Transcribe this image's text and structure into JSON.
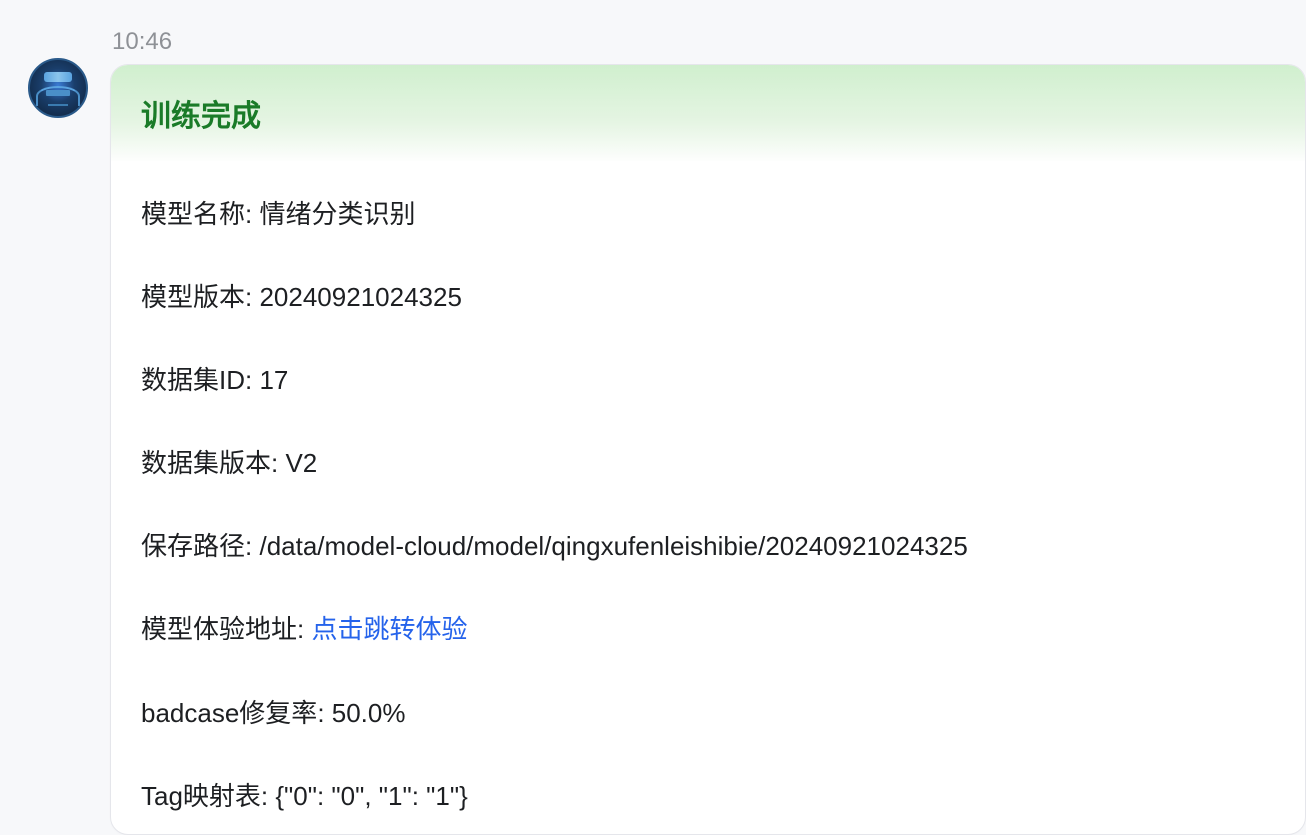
{
  "timestamp": "10:46",
  "header": {
    "title": "训练完成"
  },
  "fields": {
    "model_name": {
      "label": "模型名称",
      "value": "情绪分类识别"
    },
    "model_version": {
      "label": "模型版本",
      "value": "20240921024325"
    },
    "dataset_id": {
      "label": "数据集ID",
      "value": "17"
    },
    "dataset_version": {
      "label": "数据集版本",
      "value": "V2"
    },
    "save_path": {
      "label": "保存路径",
      "value": "/data/model-cloud/model/qingxufenleishibie/20240921024325"
    },
    "experience_url": {
      "label": "模型体验地址",
      "link_text": "点击跳转体验"
    },
    "badcase_fix_rate": {
      "label": "badcase修复率",
      "value": "50.0%"
    },
    "tag_map": {
      "label": "Tag映射表",
      "value": "{\"0\": \"0\", \"1\": \"1\"}"
    }
  },
  "colors": {
    "header_text": "#1a7b28",
    "link": "#2563eb",
    "timestamp": "#8e9196"
  }
}
